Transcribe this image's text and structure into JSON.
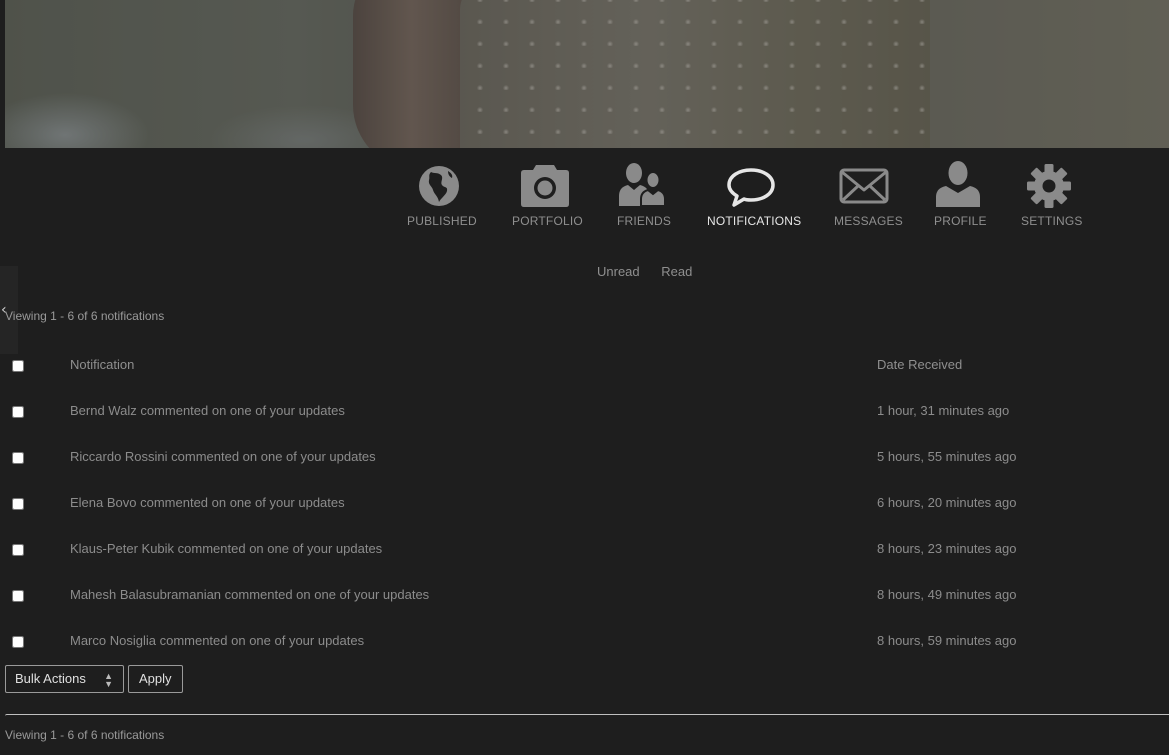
{
  "nav": {
    "items": [
      {
        "label": "PUBLISHED",
        "icon": "globe-icon",
        "active": false
      },
      {
        "label": "PORTFOLIO",
        "icon": "camera-icon",
        "active": false
      },
      {
        "label": "FRIENDS",
        "icon": "friends-icon",
        "active": false
      },
      {
        "label": "NOTIFICATIONS",
        "icon": "speech-bubble-icon",
        "active": true
      },
      {
        "label": "MESSAGES",
        "icon": "envelope-icon",
        "active": false
      },
      {
        "label": "PROFILE",
        "icon": "person-icon",
        "active": false
      },
      {
        "label": "SETTINGS",
        "icon": "gear-icon",
        "active": false
      }
    ]
  },
  "subtabs": {
    "unread": "Unread",
    "read": "Read"
  },
  "pagination": {
    "top": "Viewing 1 - 6 of 6 notifications",
    "bottom": "Viewing 1 - 6 of 6 notifications"
  },
  "table": {
    "headers": {
      "notification": "Notification",
      "date": "Date Received"
    },
    "rows": [
      {
        "text": "Bernd Walz commented on one of your updates",
        "date": "1 hour, 31 minutes ago"
      },
      {
        "text": "Riccardo Rossini commented on one of your updates",
        "date": "5 hours, 55 minutes ago"
      },
      {
        "text": "Elena Bovo commented on one of your updates",
        "date": "6 hours, 20 minutes ago"
      },
      {
        "text": "Klaus-Peter Kubik commented on one of your updates",
        "date": "8 hours, 23 minutes ago"
      },
      {
        "text": "Mahesh Balasubramanian commented on one of your updates",
        "date": "8 hours, 49 minutes ago"
      },
      {
        "text": "Marco Nosiglia commented on one of your updates",
        "date": "8 hours, 59 minutes ago"
      }
    ]
  },
  "bulk": {
    "select_value": "Bulk Actions",
    "apply_label": "Apply"
  },
  "colors": {
    "background": "#1e1e1e",
    "icon": "#8a8a8a",
    "active_label": "#e6e6e6"
  }
}
